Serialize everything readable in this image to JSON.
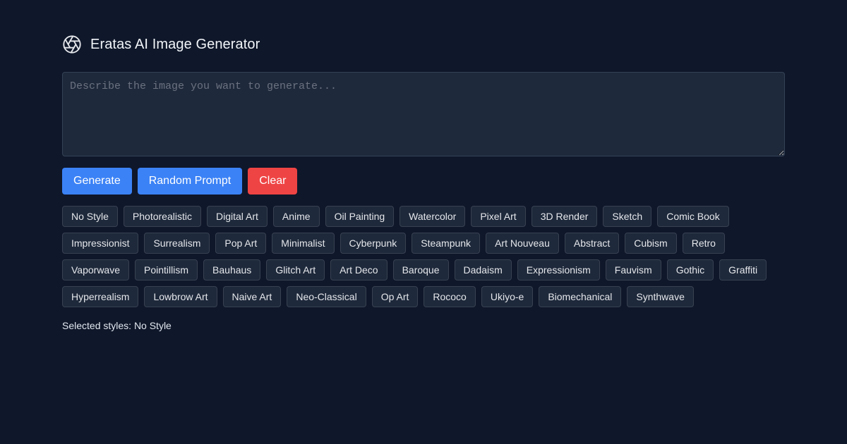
{
  "app": {
    "title": "Eratas AI Image Generator",
    "logo_icon": "aperture-icon"
  },
  "prompt": {
    "value": "",
    "placeholder": "Describe the image you want to generate..."
  },
  "actions": {
    "generate_label": "Generate",
    "random_label": "Random Prompt",
    "clear_label": "Clear"
  },
  "colors": {
    "background": "#0f172a",
    "surface": "#1e293b",
    "primary": "#3b82f6",
    "danger": "#ef4444"
  },
  "styles": [
    "No Style",
    "Photorealistic",
    "Digital Art",
    "Anime",
    "Oil Painting",
    "Watercolor",
    "Pixel Art",
    "3D Render",
    "Sketch",
    "Comic Book",
    "Impressionist",
    "Surrealism",
    "Pop Art",
    "Minimalist",
    "Cyberpunk",
    "Steampunk",
    "Art Nouveau",
    "Abstract",
    "Cubism",
    "Retro",
    "Vaporwave",
    "Pointillism",
    "Bauhaus",
    "Glitch Art",
    "Art Deco",
    "Baroque",
    "Dadaism",
    "Expressionism",
    "Fauvism",
    "Gothic",
    "Graffiti",
    "Hyperrealism",
    "Lowbrow Art",
    "Naive Art",
    "Neo-Classical",
    "Op Art",
    "Rococo",
    "Ukiyo-e",
    "Biomechanical",
    "Synthwave"
  ],
  "selection": {
    "label": "Selected styles: No Style"
  }
}
